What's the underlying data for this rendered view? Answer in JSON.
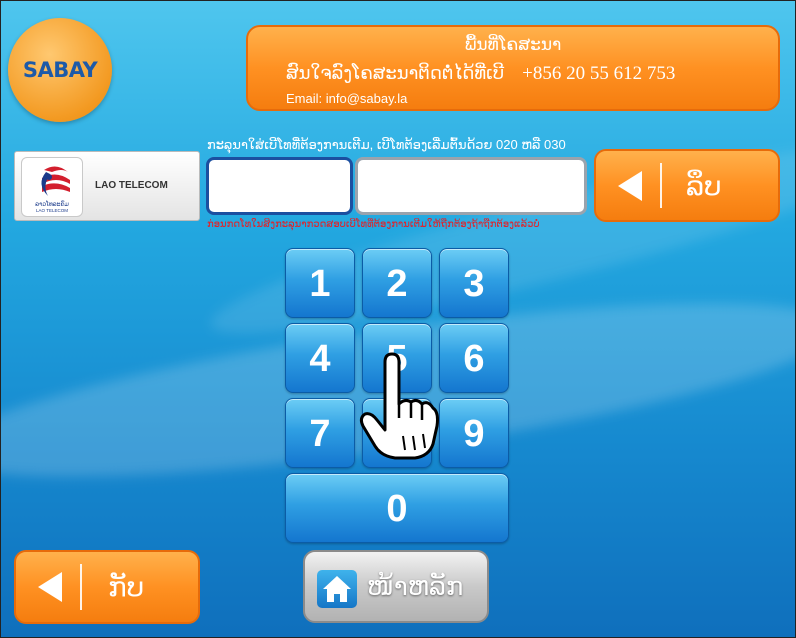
{
  "brand": {
    "logo_text": "SABAY"
  },
  "header": {
    "title": "ພື້ນທີ່ໂຄສະນາ",
    "line2_text": "ສົນໃຈລົງໂຄສະນາຕິດຕໍ່ໄດ້ທີ່ເບີ",
    "phone": "+856 20 55 612 753",
    "email": "Email:  info@sabay.la"
  },
  "instruction": {
    "text": "ກະລຸນາໃສ່ເບີໂທທີ່ຕ້ອງການເຕີມ, ເບີໂທຕ້ອງເລີ່ມຕົ້ນດ້ວຍ 020 ຫລື 030",
    "warning": "ກ່ອນກດໂທໃນສິງກະລຸນາກວດສອບເບີໂທທີ່ຕ້ອງການເຕີມໃຫ້ຖືກຕ້ອງຖ້າຖືກຕ້ອງແລ້ວບໍ່"
  },
  "operator": {
    "name": "LAO TELECOM",
    "logo_caption": "ລາວໂທລະຄົມ",
    "logo_caption_en": "LAO TELECOM"
  },
  "inputs": {
    "prefix_value": "",
    "number_value": ""
  },
  "buttons": {
    "delete_label": "ລຶບ",
    "back_label": "ກັບ",
    "home_label": "ໜ້າຫລັກ"
  },
  "keypad": {
    "keys": [
      "1",
      "2",
      "3",
      "4",
      "5",
      "6",
      "7",
      "8",
      "9",
      "0"
    ]
  },
  "colors": {
    "accent_orange": "#ff9122",
    "key_blue": "#2f9fe3",
    "warning_red": "#e0232a"
  }
}
